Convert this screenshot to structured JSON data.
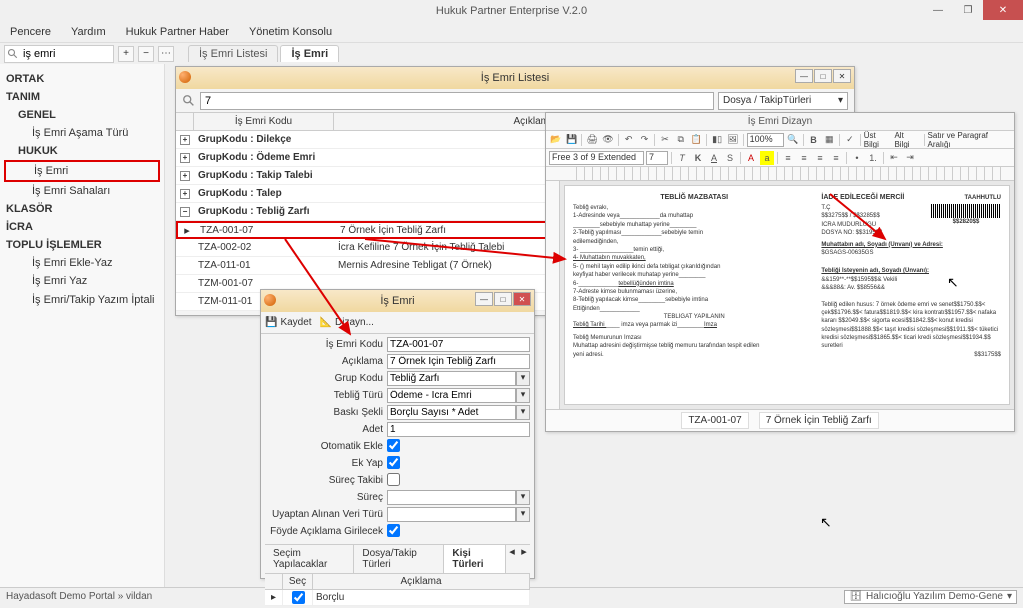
{
  "app": {
    "title": "Hukuk Partner Enterprise V.2.0"
  },
  "menubar": {
    "pencere": "Pencere",
    "yardim": "Yardım",
    "haber": "Hukuk Partner Haber",
    "konsol": "Yönetim Konsolu"
  },
  "toolbar": {
    "search_value": "iş emri"
  },
  "tabs": {
    "list": "İş Emri Listesi",
    "form": "İş Emri"
  },
  "sidebar": {
    "ortak": "ORTAK",
    "tanim": "TANIM",
    "genel": "GENEL",
    "genel_items": {
      "asama": "İş Emri Aşama Türü"
    },
    "hukuk": "HUKUK",
    "hukuk_items": {
      "is_emri": "İş Emri",
      "sahalari": "İş Emri Sahaları"
    },
    "klasor": "KLASÖR",
    "icra": "İCRA",
    "toplu": "TOPLU İŞLEMLER",
    "toplu_items": {
      "ekle": "İş Emri Ekle-Yaz",
      "yaz": "İş Emri Yaz",
      "iptal": "İş Emri/Takip Yazım İptali"
    }
  },
  "list_window": {
    "title": "İş Emri Listesi",
    "search_value": "7",
    "combo": "Dosya / TakipTürleri",
    "col_kod": "İş Emri Kodu",
    "col_aciklama": "Açıklama",
    "groups": {
      "dilekce": "GrupKodu : Dilekçe",
      "odeme": "GrupKodu : Ödeme Emri",
      "takip_talebi": "GrupKodu : Takip Talebi",
      "talep": "GrupKodu : Talep",
      "teblig": "GrupKodu : Tebliğ Zarfı"
    },
    "rows": [
      {
        "kod": "TZA-001-07",
        "aciklama": "7 Örnek İçin Tebliğ Zarfı",
        "highlighted": true
      },
      {
        "kod": "TZA-002-02",
        "aciklama": "İcra Kefiline 7 Örnek İçin Tebliğ Talebi"
      },
      {
        "kod": "TZA-011-01",
        "aciklama": "Mernis Adresine Tebligat (7 Örnek)"
      },
      {
        "kod": "TZM-001-07",
        "aciklama": ""
      },
      {
        "kod": "TZM-011-01",
        "aciklama": ""
      }
    ]
  },
  "form_window": {
    "title": "İş Emri",
    "kaydet": "Kaydet",
    "dizayn": "Dizayn...",
    "labels": {
      "kod": "İş Emri Kodu",
      "aciklama": "Açıklama",
      "grup": "Grup Kodu",
      "teblig_turu": "Tebliğ Türü",
      "baski": "Baskı Şekli",
      "adet": "Adet",
      "oto_ekle": "Otomatik Ekle",
      "ek_yap": "Ek Yap",
      "surec_takibi": "Süreç Takibi",
      "surec": "Süreç",
      "uyaptan": "Uyaptan Alınan Veri Türü",
      "foyde": "Föyde Açıklama Girilecek"
    },
    "values": {
      "kod": "TZA-001-07",
      "aciklama": "7 Örnek İçin Tebliğ Zarfı",
      "grup": "Tebliğ Zarfı",
      "teblig_turu": "Ödeme - İcra Emri",
      "baski": "Borçlu Sayısı * Adet",
      "adet": "1",
      "oto_ekle": true,
      "ek_yap": true,
      "surec_takibi": false,
      "surec": "",
      "uyaptan": "",
      "foyde": true
    },
    "tabs": {
      "secim": "Seçim Yapılacaklar",
      "dosya": "Dosya/Takip Türleri",
      "kisi": "Kişi Türleri"
    },
    "sub": {
      "sec": "Seç",
      "aciklama": "Açıklama",
      "row1": "Borçlu"
    }
  },
  "dizayn": {
    "title": "İş Emri Dizayn",
    "font_sel": "Free 3 of 9 Extended",
    "size_sel": "7",
    "zoom": "100%",
    "tool_labels": {
      "ust": "Üst Bilgi",
      "alt": "Alt Bilgi",
      "satir": "Satır ve Paragraf Aralığı"
    },
    "doc": {
      "h1": "TEBLİĞ MAZBATASI",
      "l1": "Tebliğ evrakı,",
      "l2a": "1-Adresinde veya",
      "l2b": "da muhattap",
      "l3a": "",
      "l3b": "sebebiyle muhattap yerine",
      "l3c": "",
      "l4a": "2-Tebliğ yapılması",
      "l4b": "sebebiyle temin",
      "l5": "edilemediğinden,",
      "l6a": "3- ",
      "l6b": "temin ettiği,",
      "l7": "4- Muhattabın muvakkaten,",
      "l8a": "5- (",
      "l8b": ") mehil tayin edilip ikinci defa tebligat çıkarıldığından",
      "l9a": "keyfiyat haber verilecek muhatap yerine",
      "l9b": "",
      "l10a": "6-",
      "l10b": "tebellüğünden imtina",
      "l11": "7-Adreste kimse bulunmaması üzerine,",
      "l12a": "8-Tebliğ yapılacak kimse",
      "l12b": "sebebiyle imtina",
      "l13a": "Ettiğinden",
      "l13b": "",
      "l14": "TEBLİGAT YAPILANIN",
      "l15a": "Tebliğ Tarihi ",
      "l15b": " imza veya parmak izi",
      "l15c": "İmza",
      "l16": "Tebliğ Memurunun İmzası",
      "l17": "Muhattap adresini değiştirmişse tebliğ memuru tarafından tespit edilen",
      "l18": "yeni adresi.",
      "h2": "İADE EDİLECEĞİ MERCİİ",
      "taah": "TAAHHÜTLÜ",
      "tc": "T.Ç",
      "icra1": "$$3275$$ / $$3285$$",
      "icra2": "İCRA MÜDÜRLÜĞÜ",
      "dosya": "DOSYA NO: $$3195$$",
      "barcode_no": "$$2820$$",
      "muh_head": "Muhattabın adı, Soyadı (Ünvanı) ve Adresi:",
      "muh_val": "$GSAGS-00635GS",
      "tebl_head": "Tebliği İsteyenin adı, Soyadı (Ünvanı):",
      "tebl_val1": "&&159**-**$$1595$$& Vekili",
      "tebl_val2": "&&&88&: Av. $$8556&&",
      "body1": "Tebliğ edilen husus: 7 örnek ödeme emri ve senet$$1750.$$<",
      "body2": "çek$$1796.$$< fatura$$1819.$$< kira kontratı$$1957.$$< nafaka",
      "body3": "kararı $$2049.$$< sigorta ecesi$$1842.$$< konut kredisi",
      "body4": "sözleşmesi$$1888.$$< taşıt kredisi sözleşmesi$$1911.$$< tüketici",
      "body5": "kredisi sözleşmesi$$1865.$$< ticari kredi sözleşmesi$$1934.$$",
      "body6": "suretleri",
      "bottom_no": "$$3175$$"
    },
    "status": {
      "kod": "TZA-001-07",
      "aciklama": "7 Örnek İçin Tebliğ Zarfı"
    }
  },
  "statusbar": {
    "left": "Hayadasoft Demo Portal » vildan",
    "right": "Halıcıoğlu Yazılım Demo-Gene"
  }
}
